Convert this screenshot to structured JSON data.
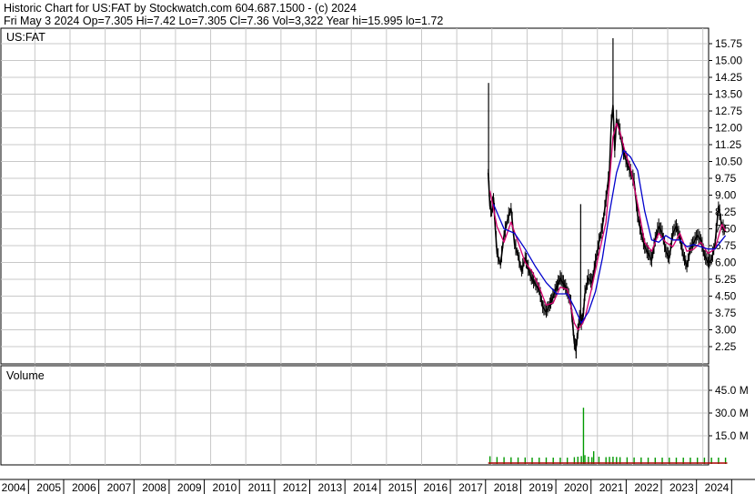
{
  "header": {
    "line1": "Historic Chart for US:FAT by Stockwatch.com 604.687.1500 - (c) 2024",
    "line2": "Fri May  3 2024   Op=7.305   Hi=7.42   Lo=7.305   Cl=7.36   Vol=3,322   Year hi=15.995   lo=1.72"
  },
  "chart_data": [
    {
      "type": "line",
      "panel": "price",
      "title": "US:FAT",
      "ylim": [
        1.72,
        16.2
      ],
      "y_ticks": [
        "15.75",
        "15.00",
        "14.25",
        "13.50",
        "12.75",
        "12.00",
        "11.25",
        "10.50",
        "9.75",
        "9.00",
        "8.25",
        "7.50",
        "6.75",
        "6.00",
        "5.25",
        "4.50",
        "3.75",
        "3.00",
        "2.25"
      ],
      "x_ticks": [
        "2004",
        "2005",
        "2006",
        "2007",
        "2008",
        "2009",
        "2010",
        "2011",
        "2012",
        "2013",
        "2014",
        "2015",
        "2016",
        "2017",
        "2018",
        "2019",
        "2020",
        "2021",
        "2022",
        "2023",
        "2024"
      ],
      "x_range": [
        2004.0,
        2024.35
      ],
      "grid": true,
      "colors": {
        "price": "#000000",
        "ma_short": "#d4006e",
        "ma_long": "#0000cc"
      },
      "series": [
        {
          "x": [
            2017.55,
            2017.6,
            2017.65,
            2017.7,
            2017.75,
            2017.8,
            2017.9,
            2018.0,
            2018.1,
            2018.2,
            2018.3,
            2018.4,
            2018.5,
            2018.6,
            2018.75,
            2018.9,
            2019.0,
            2019.1,
            2019.2,
            2019.3,
            2019.45,
            2019.6,
            2019.75,
            2019.9,
            2020.0,
            2020.05,
            2020.1,
            2020.15,
            2020.2,
            2020.25,
            2020.3,
            2020.4,
            2020.5,
            2020.6,
            2020.7,
            2020.8,
            2020.9,
            2021.0,
            2021.05,
            2021.1,
            2021.15,
            2021.2,
            2021.3,
            2021.4,
            2021.5,
            2021.6,
            2021.7,
            2021.8,
            2021.9,
            2022.0,
            2022.1,
            2022.2,
            2022.3,
            2022.4,
            2022.5,
            2022.6,
            2022.7,
            2022.8,
            2022.9,
            2023.0,
            2023.1,
            2023.2,
            2023.3,
            2023.4,
            2023.5,
            2023.6,
            2023.7,
            2023.8,
            2023.9,
            2024.0,
            2024.1,
            2024.2,
            2024.3
          ],
          "y": [
            10.0,
            8.5,
            8.2,
            8.9,
            7.6,
            6.4,
            5.9,
            7.2,
            7.9,
            8.4,
            6.8,
            6.3,
            5.6,
            6.2,
            5.4,
            5.0,
            4.8,
            4.0,
            3.8,
            4.1,
            4.7,
            5.3,
            4.9,
            4.2,
            2.4,
            2.2,
            2.9,
            3.5,
            3.3,
            3.6,
            4.6,
            5.3,
            5.1,
            6.0,
            6.9,
            7.6,
            8.8,
            10.1,
            12.2,
            13.0,
            11.0,
            12.4,
            11.8,
            10.9,
            10.4,
            10.0,
            9.6,
            8.1,
            7.3,
            6.7,
            6.4,
            6.1,
            7.0,
            7.6,
            7.3,
            6.5,
            6.2,
            7.3,
            7.6,
            7.1,
            6.3,
            5.8,
            6.6,
            6.9,
            7.2,
            7.0,
            6.3,
            6.0,
            6.1,
            6.8,
            8.5,
            7.6,
            7.36
          ]
        },
        {
          "x": [
            2017.6,
            2017.8,
            2018.0,
            2018.2,
            2018.4,
            2018.6,
            2018.8,
            2019.0,
            2019.2,
            2019.4,
            2019.6,
            2019.8,
            2020.0,
            2020.1,
            2020.2,
            2020.3,
            2020.5,
            2020.7,
            2020.9,
            2021.0,
            2021.1,
            2021.2,
            2021.3,
            2021.45,
            2021.6,
            2021.8,
            2022.0,
            2022.2,
            2022.4,
            2022.6,
            2022.8,
            2023.0,
            2023.2,
            2023.4,
            2023.6,
            2023.8,
            2024.0,
            2024.2,
            2024.3
          ],
          "y": [
            9.2,
            7.6,
            6.9,
            7.8,
            6.9,
            6.0,
            5.6,
            4.9,
            4.1,
            4.2,
            4.9,
            4.8,
            3.3,
            3.0,
            3.2,
            3.5,
            4.9,
            6.4,
            7.8,
            9.6,
            11.6,
            12.2,
            11.8,
            10.9,
            10.2,
            8.6,
            6.9,
            6.5,
            7.3,
            6.9,
            6.7,
            7.3,
            6.5,
            6.6,
            6.9,
            6.4,
            6.6,
            7.7,
            7.4
          ]
        },
        {
          "x": [
            2017.7,
            2018.0,
            2018.3,
            2018.6,
            2018.9,
            2019.2,
            2019.5,
            2019.8,
            2020.0,
            2020.2,
            2020.4,
            2020.6,
            2020.8,
            2021.0,
            2021.2,
            2021.4,
            2021.6,
            2021.8,
            2022.0,
            2022.2,
            2022.4,
            2022.6,
            2022.8,
            2023.0,
            2023.2,
            2023.4,
            2023.6,
            2023.8,
            2024.0,
            2024.2,
            2024.3
          ],
          "y": [
            8.6,
            7.5,
            7.3,
            6.6,
            5.8,
            5.1,
            4.6,
            4.6,
            4.0,
            3.3,
            3.8,
            4.7,
            6.2,
            8.2,
            10.0,
            11.0,
            10.7,
            10.1,
            8.3,
            7.0,
            6.9,
            7.2,
            7.0,
            7.0,
            6.7,
            6.8,
            6.7,
            6.6,
            6.6,
            7.0,
            7.2
          ]
        }
      ]
    },
    {
      "type": "bar",
      "panel": "volume",
      "title": "Volume",
      "y_ticks": [
        "45.0 M",
        "30.0 M",
        "15.0 M"
      ],
      "ylim": [
        0,
        53
      ],
      "color": "#009900",
      "x": [
        2017.6,
        2017.8,
        2018.0,
        2018.2,
        2018.4,
        2018.6,
        2018.8,
        2019.0,
        2019.2,
        2019.4,
        2019.6,
        2019.8,
        2020.0,
        2020.1,
        2020.2,
        2020.26,
        2020.3,
        2020.4,
        2020.5,
        2020.55,
        2020.7,
        2020.9,
        2021.0,
        2021.1,
        2021.2,
        2021.3,
        2021.5,
        2021.7,
        2021.9,
        2022.1,
        2022.3,
        2022.5,
        2022.7,
        2022.9,
        2023.1,
        2023.3,
        2023.5,
        2023.7,
        2023.9,
        2024.1,
        2024.3
      ],
      "values": [
        1.5,
        1.0,
        0.9,
        0.8,
        0.7,
        0.7,
        0.6,
        0.6,
        0.7,
        0.6,
        0.6,
        0.6,
        0.9,
        1.2,
        1.6,
        33.5,
        2.2,
        1.2,
        0.9,
        4.8,
        1.2,
        0.9,
        1.1,
        1.2,
        1.0,
        0.9,
        0.8,
        0.7,
        0.7,
        0.6,
        0.6,
        0.6,
        0.6,
        0.6,
        0.6,
        0.6,
        0.6,
        0.6,
        0.6,
        0.6,
        0.6
      ]
    }
  ]
}
